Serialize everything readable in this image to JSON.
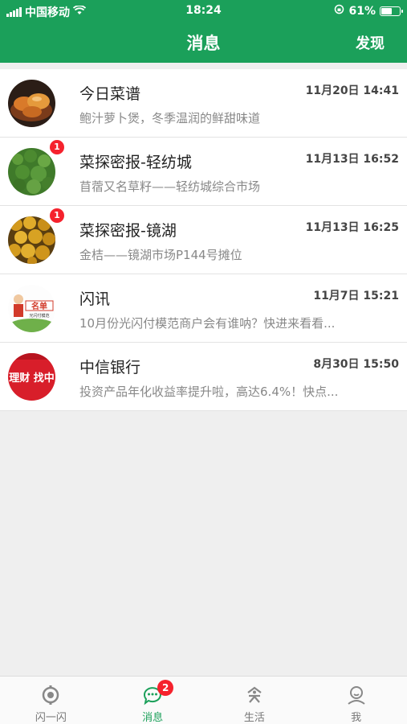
{
  "status_bar": {
    "carrier": "中国移动",
    "time": "18:24",
    "battery_percent": "61%",
    "battery_level": 0.61
  },
  "header": {
    "title": "消息",
    "right_label": "发现"
  },
  "messages": [
    {
      "title": "今日菜谱",
      "date": "11月20日 14:41",
      "subtitle": "鲍汁萝卜煲，冬季温润的鲜甜味道",
      "badge": ""
    },
    {
      "title": "菜探密报-轻纺城",
      "date": "11月13日 16:52",
      "subtitle": "苜蓿又名草籽——轻纺城综合市场",
      "badge": "1"
    },
    {
      "title": "菜探密报-镜湖",
      "date": "11月13日 16:25",
      "subtitle": "金桔——镜湖市场P144号摊位",
      "badge": "1"
    },
    {
      "title": "闪讯",
      "date": "11月7日 15:21",
      "subtitle": "10月份光闪付模范商户会有谁呐？快进来看看...",
      "badge": "",
      "avatar_text": "名单",
      "avatar_subtext": "光闪付模范"
    },
    {
      "title": "中信银行",
      "date": "8月30日 15:50",
      "subtitle": "投资产品年化收益率提升啦，高达6.4%！快点...",
      "badge": "",
      "avatar_text": "理财 找中"
    }
  ],
  "tabbar": {
    "items": [
      {
        "label": "闪一闪",
        "icon": "flash-icon"
      },
      {
        "label": "消息",
        "icon": "chat-icon",
        "badge": "2"
      },
      {
        "label": "生活",
        "icon": "life-icon"
      },
      {
        "label": "我",
        "icon": "user-icon"
      }
    ]
  },
  "colors": {
    "brand_green": "#1ba05a",
    "badge_red": "#f5222d"
  }
}
